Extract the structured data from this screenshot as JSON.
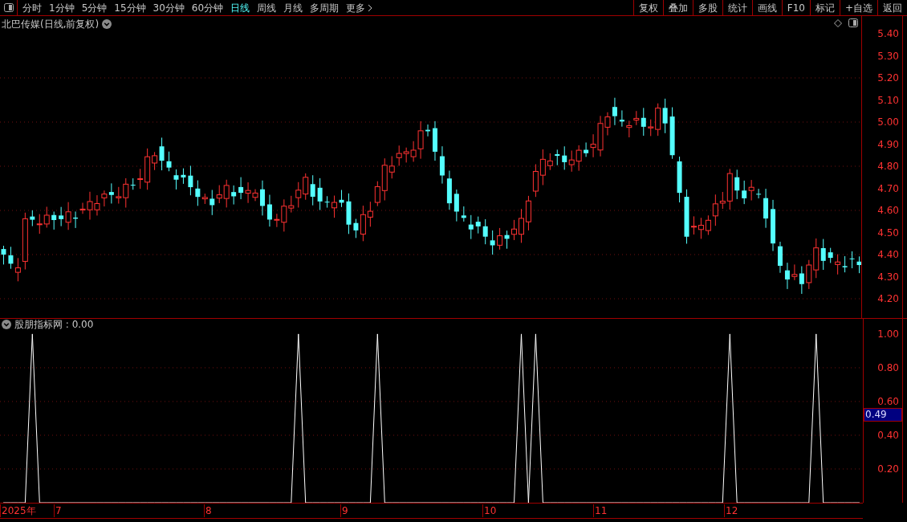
{
  "toolbar": {
    "periods": [
      {
        "label": "分时",
        "selected": false
      },
      {
        "label": "1分钟",
        "selected": false
      },
      {
        "label": "5分钟",
        "selected": false
      },
      {
        "label": "15分钟",
        "selected": false
      },
      {
        "label": "30分钟",
        "selected": false
      },
      {
        "label": "60分钟",
        "selected": false
      },
      {
        "label": "日线",
        "selected": true
      },
      {
        "label": "周线",
        "selected": false
      },
      {
        "label": "月线",
        "selected": false
      },
      {
        "label": "多周期",
        "selected": false
      }
    ],
    "more": "更多",
    "actions": [
      "复权",
      "叠加",
      "多股",
      "统计",
      "画线",
      "F10",
      "标记",
      "+自选",
      "返回"
    ]
  },
  "main_chart": {
    "title": "北巴传媒(日线,前复权)",
    "price_ticks": [
      "5.40",
      "5.30",
      "5.20",
      "5.10",
      "5.00",
      "4.90",
      "4.80",
      "4.70",
      "4.60",
      "4.50",
      "4.40",
      "4.30",
      "4.20"
    ]
  },
  "indicator": {
    "title": "股朋指标网 : 0.00",
    "cursor_value": "0.49",
    "chart_data": {
      "type": "line",
      "grid": true,
      "ylim": [
        0,
        1.09
      ],
      "yticks": [
        {
          "value": 0.2,
          "label": "0.20"
        },
        {
          "value": 0.4,
          "label": "0.40"
        },
        {
          "value": 0.6,
          "label": "0.60"
        },
        {
          "value": 0.8,
          "label": "0.80"
        },
        {
          "value": 1,
          "label": "1.00"
        }
      ],
      "series": [
        {
          "color": "#ffffff",
          "values": [
            0,
            0,
            0,
            0,
            1,
            0,
            0,
            0,
            0,
            0,
            0,
            0,
            0,
            0,
            0,
            0,
            0,
            0,
            0,
            0,
            0,
            0,
            0,
            0,
            0,
            0,
            0,
            0,
            0,
            0,
            0,
            0,
            0,
            0,
            0,
            0,
            0,
            0,
            0,
            0,
            0,
            1,
            0,
            0,
            0,
            0,
            0,
            0,
            0,
            0,
            0,
            0,
            1,
            0,
            0,
            0,
            0,
            0,
            0,
            0,
            0,
            0,
            0,
            0,
            0,
            0,
            0,
            0,
            0,
            0,
            0,
            0,
            1,
            0,
            1,
            0,
            0,
            0,
            0,
            0,
            0,
            0,
            0,
            0,
            0,
            0,
            0,
            0,
            0,
            0,
            0,
            0,
            0,
            0,
            0,
            0,
            0,
            0,
            0,
            0,
            0,
            1,
            0,
            0,
            0,
            0,
            0,
            0,
            0,
            0,
            0,
            0,
            0,
            1,
            0,
            0,
            0,
            0,
            0,
            0
          ]
        }
      ]
    }
  },
  "date_axis": [
    "2025年",
    "7",
    "8",
    "9",
    "10",
    "11",
    "12"
  ]
}
